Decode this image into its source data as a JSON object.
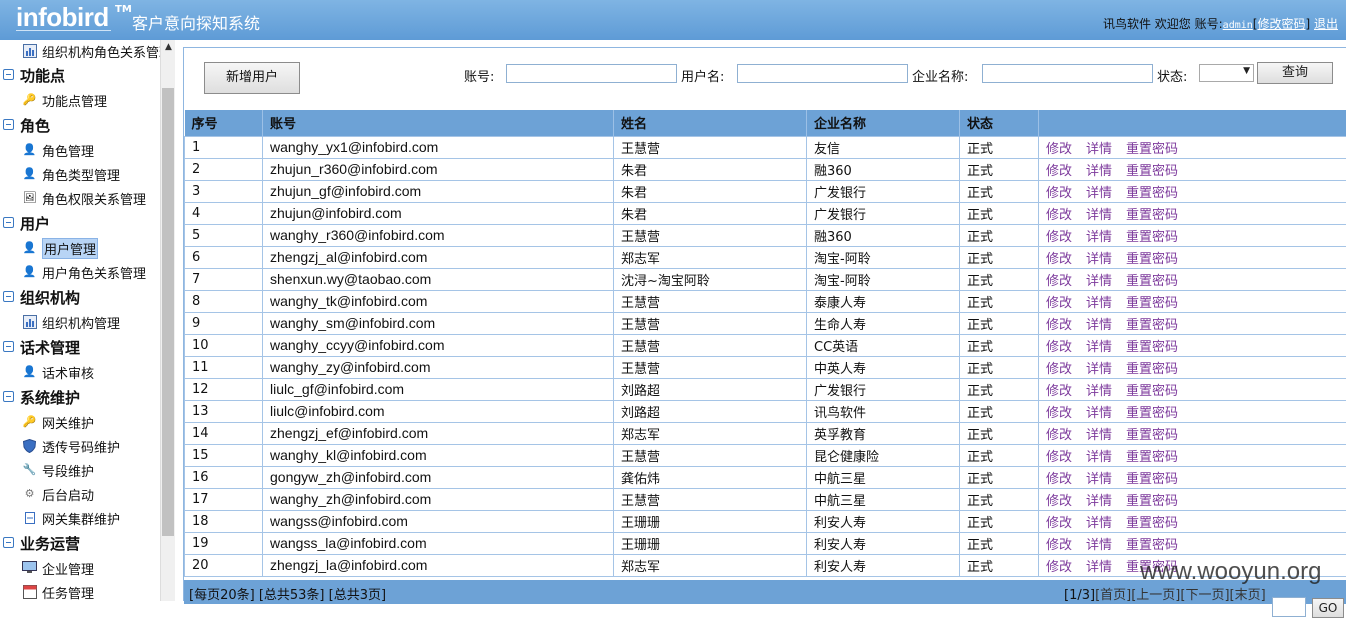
{
  "header": {
    "logo": "infobird",
    "tm": "TM",
    "title": "客户意向探知系统",
    "company": "讯鸟软件",
    "welcome": "欢迎您",
    "account_label": "账号:",
    "account": "admin",
    "change_pwd": "修改密码",
    "logout": "退出"
  },
  "sidebar": {
    "top_item": "组织机构角色关系管理",
    "groups": [
      {
        "label": "功能点",
        "items": [
          {
            "label": "功能点管理",
            "icon": "key-icon"
          }
        ]
      },
      {
        "label": "角色",
        "items": [
          {
            "label": "角色管理",
            "icon": "user-icon"
          },
          {
            "label": "角色类型管理",
            "icon": "user-icon"
          },
          {
            "label": "角色权限关系管理",
            "icon": "permission-icon"
          }
        ]
      },
      {
        "label": "用户",
        "items": [
          {
            "label": "用户管理",
            "icon": "user-icon"
          },
          {
            "label": "用户角色关系管理",
            "icon": "user-icon"
          }
        ]
      },
      {
        "label": "组织机构",
        "items": [
          {
            "label": "组织机构管理",
            "icon": "org-icon"
          }
        ]
      },
      {
        "label": "话术管理",
        "items": [
          {
            "label": "话术审核",
            "icon": "review-icon"
          }
        ]
      },
      {
        "label": "系统维护",
        "items": [
          {
            "label": "网关维护",
            "icon": "key-icon"
          },
          {
            "label": "透传号码维护",
            "icon": "shield-icon"
          },
          {
            "label": "号段维护",
            "icon": "tool-icon"
          },
          {
            "label": "后台启动",
            "icon": "gear-icon"
          },
          {
            "label": "网关集群维护",
            "icon": "cluster-icon"
          }
        ]
      },
      {
        "label": "业务运营",
        "items": [
          {
            "label": "企业管理",
            "icon": "monitor-icon"
          },
          {
            "label": "任务管理",
            "icon": "calendar-icon"
          }
        ]
      }
    ]
  },
  "toolbar": {
    "new_user": "新增用户",
    "account_label": "账号:",
    "account_value": "",
    "username_label": "用户名:",
    "username_value": "",
    "company_label": "企业名称:",
    "company_value": "",
    "status_label": "状态:",
    "status_value": "",
    "query": "查询"
  },
  "table": {
    "columns": [
      "序号",
      "账号",
      "姓名",
      "企业名称",
      "状态",
      ""
    ],
    "actions": [
      "修改",
      "详情",
      "重置密码"
    ],
    "rows": [
      [
        "1",
        "wanghy_yx1@infobird.com",
        "王慧营",
        "友信",
        "正式"
      ],
      [
        "2",
        "zhujun_r360@infobird.com",
        "朱君",
        "融360",
        "正式"
      ],
      [
        "3",
        "zhujun_gf@infobird.com",
        "朱君",
        "广发银行",
        "正式"
      ],
      [
        "4",
        "zhujun@infobird.com",
        "朱君",
        "广发银行",
        "正式"
      ],
      [
        "5",
        "wanghy_r360@infobird.com",
        "王慧营",
        "融360",
        "正式"
      ],
      [
        "6",
        "zhengzj_al@infobird.com",
        "郑志军",
        "淘宝-阿聆",
        "正式"
      ],
      [
        "7",
        "shenxun.wy@taobao.com",
        "沈浔~淘宝阿聆",
        "淘宝-阿聆",
        "正式"
      ],
      [
        "8",
        "wanghy_tk@infobird.com",
        "王慧营",
        "泰康人寿",
        "正式"
      ],
      [
        "9",
        "wanghy_sm@infobird.com",
        "王慧营",
        "生命人寿",
        "正式"
      ],
      [
        "10",
        "wanghy_ccyy@infobird.com",
        "王慧营",
        "CC英语",
        "正式"
      ],
      [
        "11",
        "wanghy_zy@infobird.com",
        "王慧营",
        "中英人寿",
        "正式"
      ],
      [
        "12",
        "liulc_gf@infobird.com",
        "刘路超",
        "广发银行",
        "正式"
      ],
      [
        "13",
        "liulc@infobird.com",
        "刘路超",
        "讯鸟软件",
        "正式"
      ],
      [
        "14",
        "zhengzj_ef@infobird.com",
        "郑志军",
        "英孚教育",
        "正式"
      ],
      [
        "15",
        "wanghy_kl@infobird.com",
        "王慧营",
        "昆仑健康险",
        "正式"
      ],
      [
        "16",
        "gongyw_zh@infobird.com",
        "龚佑炜",
        "中航三星",
        "正式"
      ],
      [
        "17",
        "wanghy_zh@infobird.com",
        "王慧营",
        "中航三星",
        "正式"
      ],
      [
        "18",
        "wangss@infobird.com",
        "王珊珊",
        "利安人寿",
        "正式"
      ],
      [
        "19",
        "wangss_la@infobird.com",
        "王珊珊",
        "利安人寿",
        "正式"
      ],
      [
        "20",
        "zhengzj_la@infobird.com",
        "郑志军",
        "利安人寿",
        "正式"
      ]
    ]
  },
  "pager": {
    "summary": "[每页20条] [总共53条] [总共3页]",
    "page": "[1/3]",
    "first": "[首页]",
    "prev": "[上一页]",
    "next": "[下一页]",
    "last": "[末页]",
    "go": "GO"
  },
  "watermark": "www.wooyun.org"
}
